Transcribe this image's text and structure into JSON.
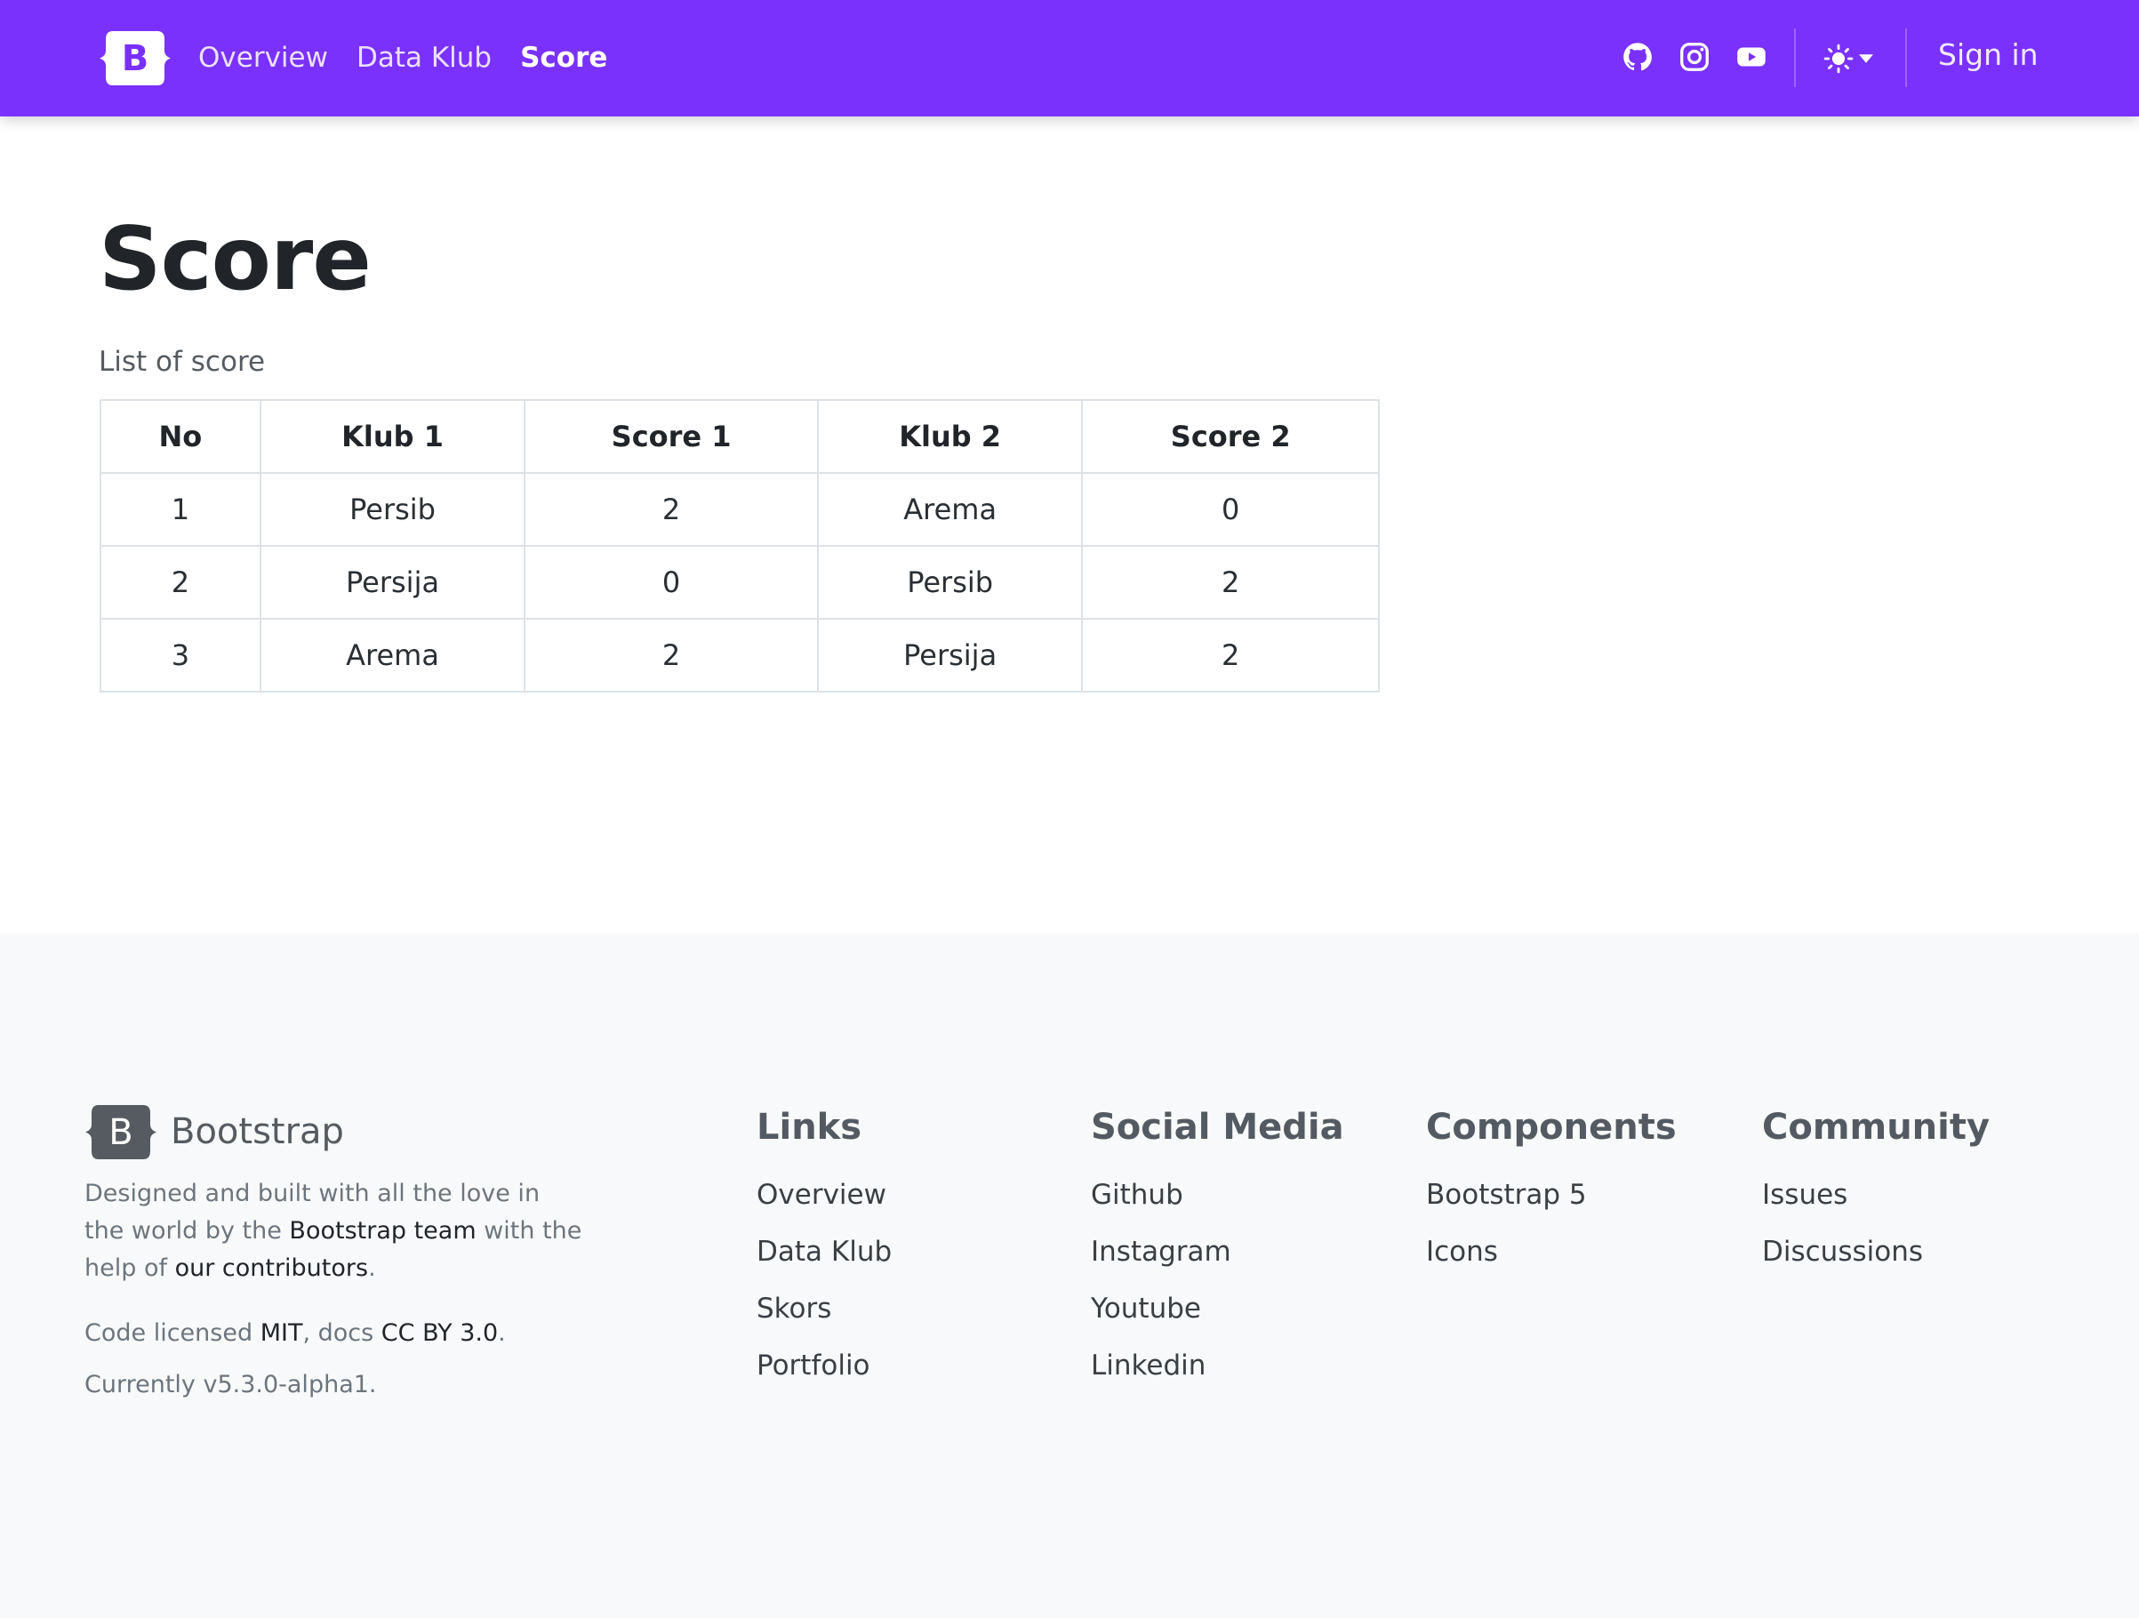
{
  "navbar": {
    "brand_letter": "B",
    "links": [
      {
        "label": "Overview",
        "active": false
      },
      {
        "label": "Data Klub",
        "active": false
      },
      {
        "label": "Score",
        "active": true
      }
    ],
    "social_icons": [
      "github-icon",
      "instagram-icon",
      "youtube-icon"
    ],
    "theme_icon": "sun-icon",
    "signin_label": "Sign in",
    "accent_color": "#7a31fb"
  },
  "main": {
    "title": "Score",
    "subtitle": "List of score",
    "table": {
      "headers": [
        "No",
        "Klub 1",
        "Score 1",
        "Klub 2",
        "Score 2"
      ],
      "rows": [
        [
          "1",
          "Persib",
          "2",
          "Arema",
          "0"
        ],
        [
          "2",
          "Persija",
          "0",
          "Persib",
          "2"
        ],
        [
          "3",
          "Arema",
          "2",
          "Persija",
          "2"
        ]
      ]
    }
  },
  "footer": {
    "brand_letter": "B",
    "brand_name": "Bootstrap",
    "desc_1": "Designed and built with all the love in the world by the ",
    "desc_link_team": "Bootstrap team",
    "desc_2": " with the help of ",
    "desc_link_contributors": "our contributors",
    "desc_3": ".",
    "license_1": "Code licensed ",
    "license_mit": "MIT",
    "license_2": ", docs ",
    "license_cc": "CC BY 3.0",
    "license_3": ".",
    "version": "Currently v5.3.0-alpha1.",
    "columns": [
      {
        "title": "Links",
        "items": [
          "Overview",
          "Data Klub",
          "Skors",
          "Portfolio"
        ]
      },
      {
        "title": "Social Media",
        "items": [
          "Github",
          "Instagram",
          "Youtube",
          "Linkedin"
        ]
      },
      {
        "title": "Components",
        "items": [
          "Bootstrap 5",
          "Icons"
        ]
      },
      {
        "title": "Community",
        "items": [
          "Issues",
          "Discussions"
        ]
      }
    ]
  }
}
